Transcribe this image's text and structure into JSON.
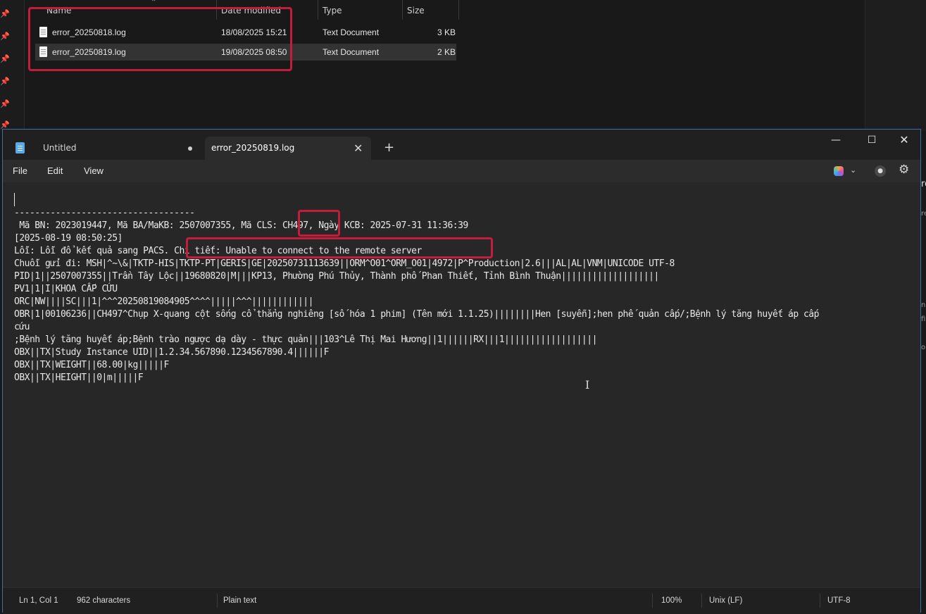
{
  "explorer": {
    "columns": [
      "Name",
      "Date modified",
      "Type",
      "Size"
    ],
    "files": [
      {
        "name": "error_20250818.log",
        "date": "18/08/2025 15:21",
        "type": "Text Document",
        "size": "3 KB"
      },
      {
        "name": "error_20250819.log",
        "date": "19/08/2025 08:50",
        "type": "Text Document",
        "size": "2 KB"
      }
    ]
  },
  "notepad": {
    "tabs": [
      {
        "label": "Untitled"
      },
      {
        "label": "error_20250819.log"
      }
    ],
    "menu": [
      "File",
      "Edit",
      "View"
    ],
    "lines": [
      "-----------------------------------",
      " Mã BN: 2023019447, Mã BA/MaKB: 2507007355, Mã CLS: CH497, Ngày KCB: 2025-07-31 11:36:39",
      "[2025-08-19 08:50:25]",
      "Lỗi: Lỗi đổ kết quả sang PACS. Chi tiết: Unable to connect to the remote server",
      "Chuỗi gửi đi: MSH|^~\\&|TKTP-HIS|TKTP-PT|GERIS|GE|20250731113639||ORM^O01^ORM_O01|4972|P^Production|2.6|||AL|AL|VNM|UNICODE UTF-8",
      "PID|1||2507007355||Trần Tây Lộc||19680820|M|||KP13, Phường Phú Thủy, Thành phố Phan Thiết, Tỉnh Bình Thuận|||||||||||||||||||",
      "PV1|1|I|KHOA CẤP CỨU",
      "ORC|NW||||SC|||1|^^^20250819084905^^^^|||||^^^||||||||||||",
      "OBR|1|00106236||CH497^Chụp X-quang cột sống cổ thẳng nghiêng [số hóa 1 phim] (Tên mới 1.1.25)||||||||Hen [suyễn];hen phế quản cấp/;Bệnh lý tăng huyết áp cấp",
      "cứu",
      ";Bệnh lý tăng huyết áp;Bệnh trào ngược dạ dày - thực quản|||103^Lê Thị Mai Hương||1||||||RX|||1||||||||||||||||||",
      "OBX||TX|Study Instance UID||1.2.34.567890.1234567890.4||||||F",
      "OBX||TX|WEIGHT||68.00|kg|||||F",
      "OBX||TX|HEIGHT||0|m|||||F"
    ],
    "status": {
      "position": "Ln 1, Col 1",
      "characters": "962 characters",
      "format": "Plain text",
      "zoom": "100%",
      "line_ending": "Unix (LF)",
      "encoding": "UTF-8"
    }
  },
  "side_fragments": [
    "re",
    "n",
    "fi",
    "o"
  ],
  "colors": {
    "highlight_box": "#c21d3d",
    "window_border": "#3e6fa8"
  }
}
